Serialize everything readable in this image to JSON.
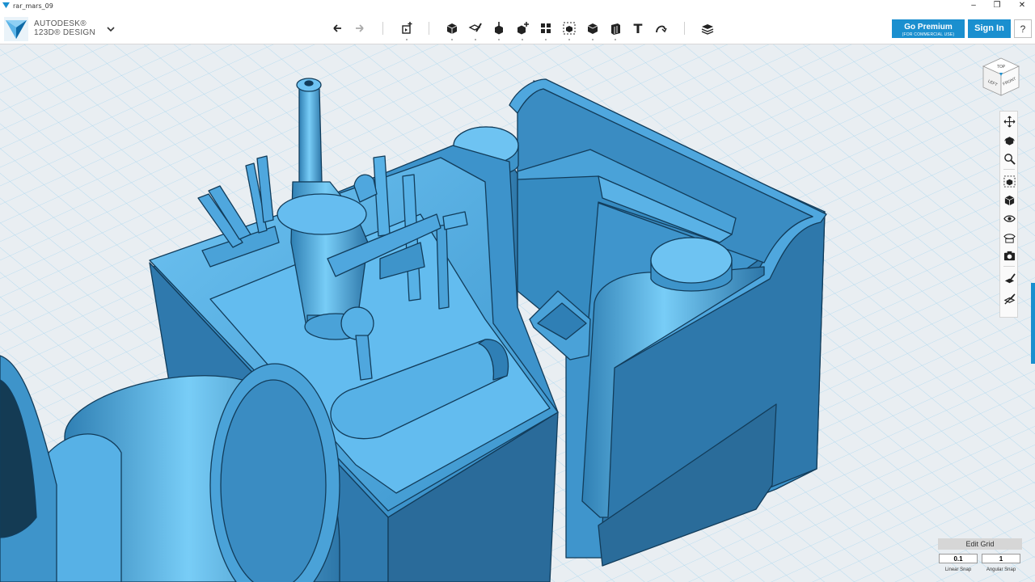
{
  "window": {
    "title": "rar_mars_09",
    "minimize_glyph": "–",
    "maximize_glyph": "❐",
    "close_glyph": "✕"
  },
  "brand": {
    "line1": "AUTODESK®",
    "line2": "123D® DESIGN",
    "icon": "autodesk-123d-logo",
    "menu_icon": "chevron-down-icon"
  },
  "toolbar": {
    "tools": [
      {
        "name": "undo",
        "icon": "undo-icon"
      },
      {
        "name": "redo",
        "icon": "redo-icon"
      },
      {
        "name": "transform",
        "icon": "transform-icon"
      },
      {
        "name": "primitives",
        "icon": "primitives-box-icon"
      },
      {
        "name": "sketch",
        "icon": "sketch-icon"
      },
      {
        "name": "construct",
        "icon": "construct-icon"
      },
      {
        "name": "modify",
        "icon": "modify-icon"
      },
      {
        "name": "pattern",
        "icon": "pattern-icon"
      },
      {
        "name": "grouping",
        "icon": "grouping-icon"
      },
      {
        "name": "combine",
        "icon": "combine-icon"
      },
      {
        "name": "measure",
        "icon": "measure-icon"
      },
      {
        "name": "text",
        "icon": "text-icon",
        "glyph": "T"
      },
      {
        "name": "snap",
        "icon": "snap-icon"
      },
      {
        "name": "material",
        "icon": "material-icon"
      }
    ]
  },
  "header_buttons": {
    "premium_label": "Go Premium",
    "premium_sub": "(FOR COMMERCIAL USE)",
    "signin_label": "Sign In",
    "help_label": "?"
  },
  "navcube": {
    "top": "TOP",
    "left": "LEFT",
    "front": "FRONT"
  },
  "navbar": {
    "items": [
      {
        "name": "pan",
        "icon": "pan-icon"
      },
      {
        "name": "orbit",
        "icon": "orbit-icon"
      },
      {
        "name": "zoom",
        "icon": "zoom-icon"
      },
      {
        "name": "fit",
        "icon": "fit-icon"
      },
      {
        "name": "views",
        "icon": "view-cube-icon"
      },
      {
        "name": "visibility",
        "icon": "eye-icon"
      },
      {
        "name": "materials-visibility",
        "icon": "material-eye-icon"
      },
      {
        "name": "screenshot",
        "icon": "camera-icon"
      },
      {
        "name": "show-hide-sketches",
        "icon": "sketch-visibility-icon"
      },
      {
        "name": "hide-all",
        "icon": "hide-icon"
      }
    ]
  },
  "edit_grid": {
    "title": "Edit Grid",
    "linear_snap_value": "0.1",
    "angular_snap_value": "1",
    "linear_snap_label": "Linear Snap",
    "angular_snap_label": "Angular Snap"
  },
  "colors": {
    "model_fill": "#4ea6dc",
    "model_light": "#6ec3f2",
    "model_dark": "#2f78a8",
    "model_edge": "#123c5a",
    "grid_line": "#9fd2ee",
    "grid_bg": "#e9eef2",
    "accent": "#1a8fcf"
  }
}
